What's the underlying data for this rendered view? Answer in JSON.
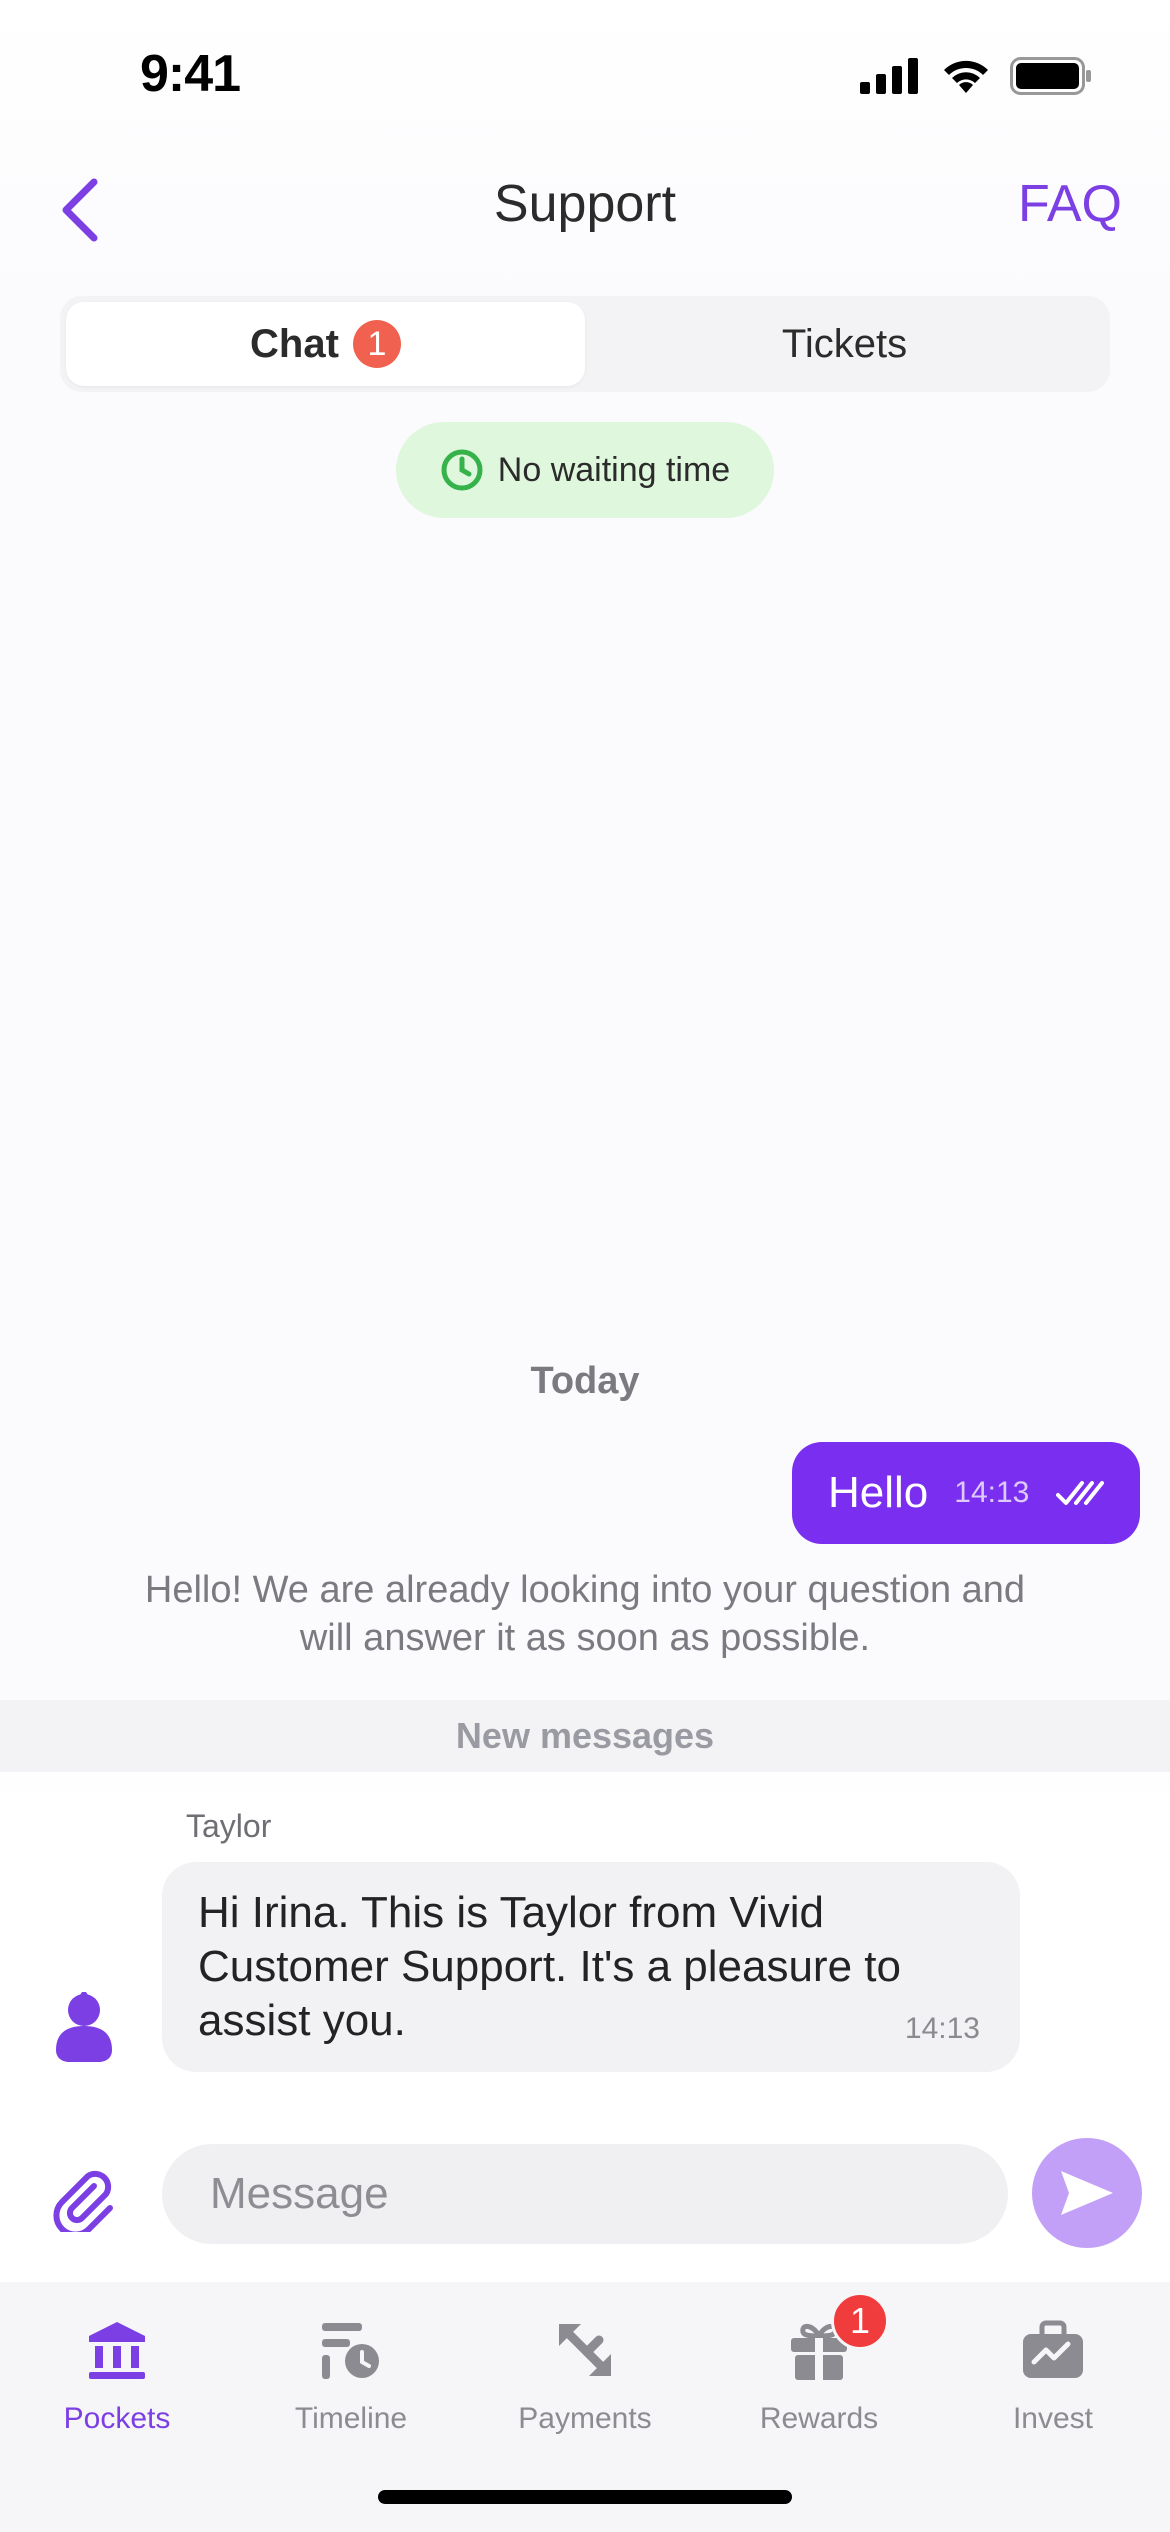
{
  "status_bar": {
    "time": "9:41"
  },
  "header": {
    "title": "Support",
    "faq_label": "FAQ"
  },
  "segments": {
    "chat_label": "Chat",
    "chat_badge": "1",
    "tickets_label": "Tickets"
  },
  "wait_status": {
    "text": "No waiting time",
    "color": "#36b24a"
  },
  "chat": {
    "date_separator": "Today",
    "outgoing": {
      "text": "Hello",
      "time": "14:13"
    },
    "system_message": "Hello! We are already looking into your question and will answer it as soon as possible.",
    "new_messages_label": "New messages",
    "incoming": {
      "sender": "Taylor",
      "text": "Hi Irina. This is Taylor from Vivid Customer Support.  It's a pleasure to assist you.",
      "time": "14:13"
    }
  },
  "composer": {
    "placeholder": "Message"
  },
  "tabs": [
    {
      "label": "Pockets",
      "icon": "bank-icon",
      "active": true
    },
    {
      "label": "Timeline",
      "icon": "timeline-icon"
    },
    {
      "label": "Payments",
      "icon": "payments-icon"
    },
    {
      "label": "Rewards",
      "icon": "gift-icon",
      "badge": "1"
    },
    {
      "label": "Invest",
      "icon": "briefcase-icon"
    }
  ],
  "colors": {
    "accent": "#7b3fe4",
    "bubble_out": "#7a2ef0",
    "badge": "#f03c3c"
  }
}
